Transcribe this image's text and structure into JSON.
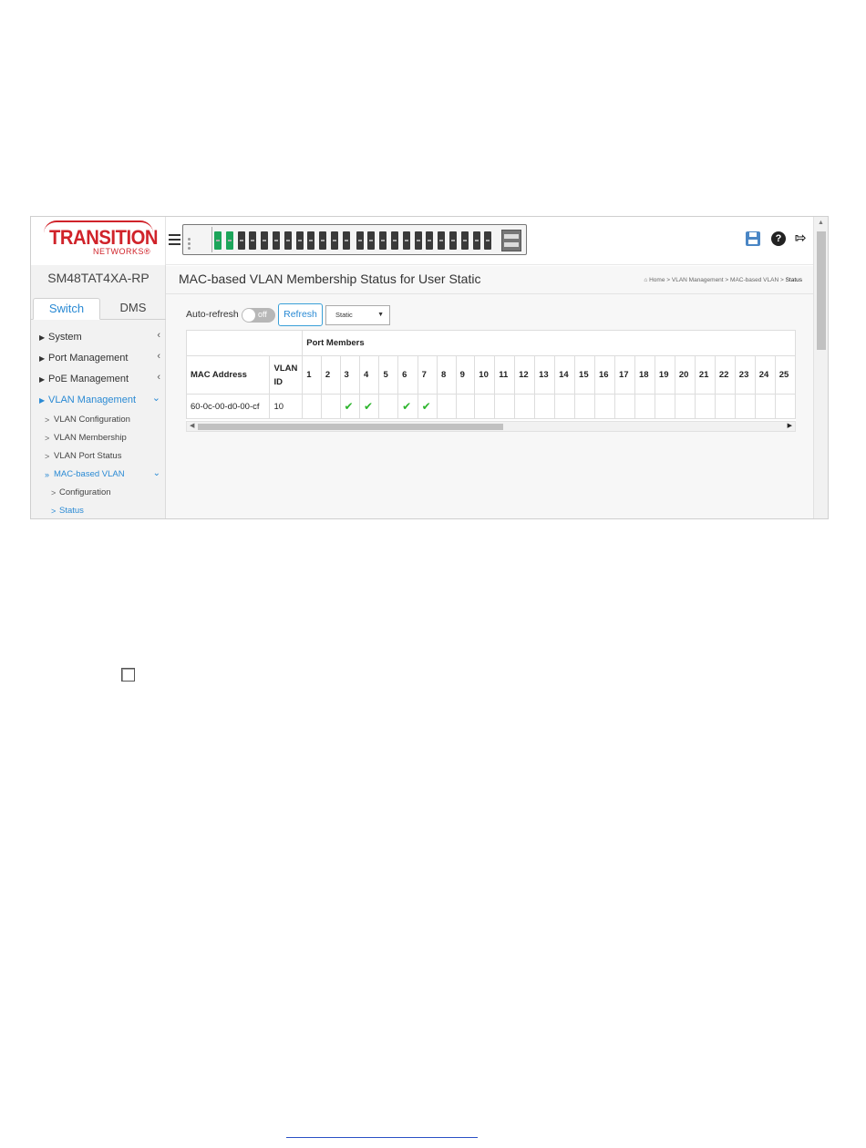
{
  "brand": {
    "logo_main": "TRANSITION",
    "logo_sub": "NETWORKS®"
  },
  "sidebar": {
    "model": "SM48TAT4XA-RP",
    "tabs": [
      {
        "label": "Switch"
      },
      {
        "label": "DMS"
      }
    ],
    "menu": [
      {
        "label": "System"
      },
      {
        "label": "Port Management"
      },
      {
        "label": "PoE Management"
      },
      {
        "label": "VLAN Management"
      }
    ],
    "submenu": [
      {
        "label": "VLAN Configuration"
      },
      {
        "label": "VLAN Membership"
      },
      {
        "label": "VLAN Port Status"
      },
      {
        "label": "MAC-based VLAN"
      }
    ],
    "subsubmenu": [
      {
        "label": "Configuration"
      },
      {
        "label": "Status"
      }
    ]
  },
  "page": {
    "title": "MAC-based VLAN Membership Status for User Static",
    "breadcrumb": {
      "home": "Home",
      "b1": "VLAN Management",
      "b2": "MAC-based VLAN",
      "last": "Status",
      "sep": ">"
    }
  },
  "controls": {
    "auto_refresh_label": "Auto-refresh",
    "toggle_text": "off",
    "refresh_button": "Refresh",
    "select_value": "Static"
  },
  "table": {
    "group_header": "Port Members",
    "col_mac": "MAC Address",
    "col_vlan": "VLAN ID",
    "ports": [
      "1",
      "2",
      "3",
      "4",
      "5",
      "6",
      "7",
      "8",
      "9",
      "10",
      "11",
      "12",
      "13",
      "14",
      "15",
      "16",
      "17",
      "18",
      "19",
      "20",
      "21",
      "22",
      "23",
      "24",
      "25"
    ],
    "rows": [
      {
        "mac": "60-0c-00-d0-00-cf",
        "vlan": "10",
        "members": [
          3,
          4,
          6,
          7
        ]
      }
    ]
  },
  "icons": {
    "save": "save-icon",
    "help": "help-icon",
    "logout": "logout-icon",
    "check_color": "#2db52d",
    "accent": "#2a8ad4",
    "brand_red": "#d0232a"
  },
  "panel": {
    "up_ports": [
      1,
      2
    ]
  }
}
